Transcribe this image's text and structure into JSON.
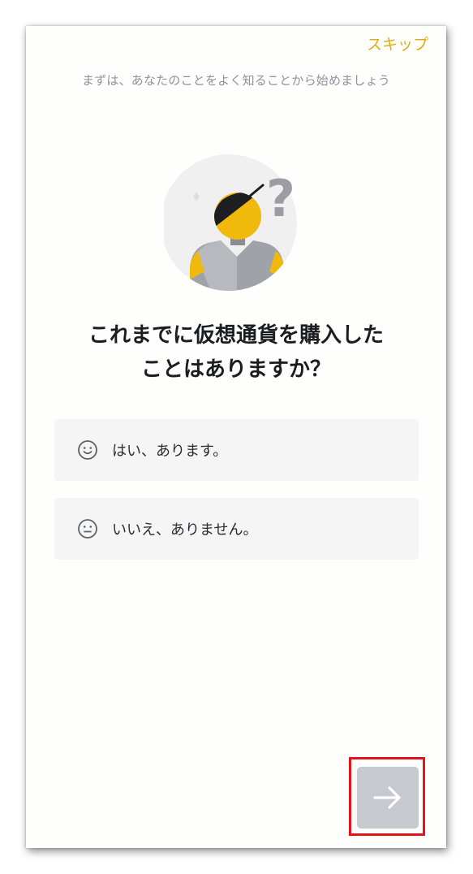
{
  "header": {
    "skip_label": "スキップ",
    "subtitle": "まずは、あなたのことをよく知ることから始めましょう"
  },
  "question": {
    "line1": "これまでに仮想通貨を購入した",
    "line2": "ことはありますか？"
  },
  "options": [
    {
      "label": "はい、あります。",
      "icon": "smile-face-icon"
    },
    {
      "label": "いいえ、ありません。",
      "icon": "neutral-face-icon"
    }
  ],
  "next_button": {
    "icon": "arrow-right-icon",
    "state": "disabled"
  },
  "colors": {
    "accent": "#e0ad10",
    "subtitle": "#8d929c",
    "option_bg": "#f5f5f5",
    "next_disabled": "#c6c9cf",
    "highlight": "#e5141c"
  }
}
